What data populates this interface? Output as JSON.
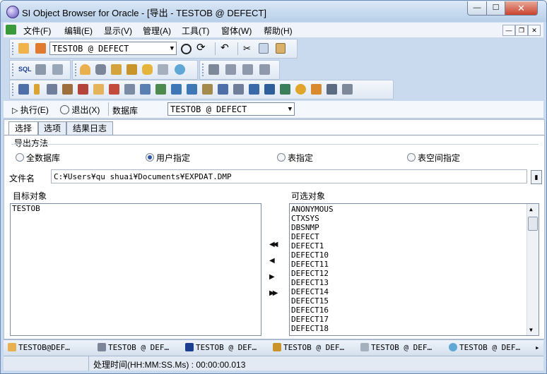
{
  "window": {
    "title": "SI Object Browser for Oracle - [导出 - TESTOB @ DEFECT]",
    "minimize_glyph": "—",
    "maximize_glyph": "☐",
    "close_glyph": "✕"
  },
  "menu": [
    "文件(F)",
    "编辑(E)",
    "显示(V)",
    "管理(A)",
    "工具(T)",
    "窗体(W)",
    "帮助(H)"
  ],
  "toolbar": {
    "connection": "TESTOB @ DEFECT"
  },
  "exec_bar": {
    "execute_label": "执行(E)",
    "exit_label": "退出(X)",
    "database_label": "数据库",
    "database_value": "TESTOB @ DEFECT"
  },
  "tabs": [
    "选择",
    "选项",
    "结果日志"
  ],
  "export_method": {
    "label": "导出方法",
    "options": [
      "全数据库",
      "用户指定",
      "表指定",
      "表空间指定"
    ],
    "selected_index": 1
  },
  "file": {
    "label": "文件名",
    "value": "C:¥Users¥qu shuai¥Documents¥EXPDAT.DMP"
  },
  "target": {
    "label": "目标对象",
    "items": [
      "TESTOB"
    ]
  },
  "available": {
    "label": "可选对象",
    "items": [
      "ANONYMOUS",
      "CTXSYS",
      "DBSNMP",
      "DEFECT",
      "DEFECT1",
      "DEFECT10",
      "DEFECT11",
      "DEFECT12",
      "DEFECT13",
      "DEFECT14",
      "DEFECT15",
      "DEFECT16",
      "DEFECT17",
      "DEFECT18"
    ]
  },
  "transfer_buttons": [
    "◀◀",
    "◀",
    "▶",
    "▶▶"
  ],
  "taskbar": [
    "TESTOB@DEF…",
    "TESTOB @ DEF…",
    "TESTOB @ DEF…",
    "TESTOB @ DEF…",
    "TESTOB @ DEF…",
    "TESTOB @ DEF…"
  ],
  "taskbar_more": "▸",
  "status": {
    "text": "处理时间(HH:MM:SS.Ms) : 00:00:00.013"
  },
  "colors": {
    "title_bar": "#c4d7ee",
    "accent": "#2d58a8",
    "close": "#c8432e"
  }
}
